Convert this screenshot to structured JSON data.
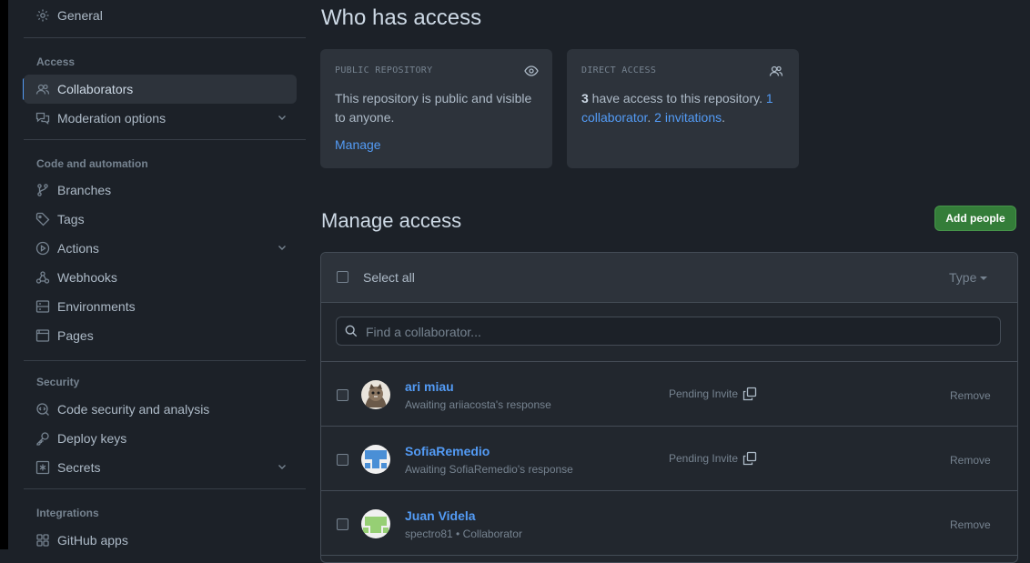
{
  "sidebar": {
    "general": {
      "label": "General",
      "icon": "gear-icon"
    },
    "sections": {
      "access": "Access",
      "code_automation": "Code and automation",
      "security": "Security",
      "integrations": "Integrations"
    },
    "items": {
      "collaborators": {
        "label": "Collaborators",
        "icon": "people-icon"
      },
      "moderation": {
        "label": "Moderation options",
        "icon": "comment-discussion-icon"
      },
      "branches": {
        "label": "Branches",
        "icon": "git-branch-icon"
      },
      "tags": {
        "label": "Tags",
        "icon": "tag-icon"
      },
      "actions": {
        "label": "Actions",
        "icon": "play-icon"
      },
      "webhooks": {
        "label": "Webhooks",
        "icon": "webhook-icon"
      },
      "environments": {
        "label": "Environments",
        "icon": "server-icon"
      },
      "pages": {
        "label": "Pages",
        "icon": "browser-icon"
      },
      "code_security": {
        "label": "Code security and analysis",
        "icon": "codescan-icon"
      },
      "deploy_keys": {
        "label": "Deploy keys",
        "icon": "key-icon"
      },
      "secrets": {
        "label": "Secrets",
        "icon": "asterisk-icon"
      },
      "github_apps": {
        "label": "GitHub apps",
        "icon": "apps-icon"
      }
    }
  },
  "who_has_access": {
    "title": "Who has access",
    "public_card": {
      "label": "PUBLIC REPOSITORY",
      "text": "This repository is public and visible to anyone.",
      "link": "Manage"
    },
    "direct_card": {
      "label": "DIRECT ACCESS",
      "count": "3",
      "text_mid": " have access to this repository. ",
      "collab_link": "1 collaborator",
      "sep": ". ",
      "invite_link": "2 invitations",
      "end": "."
    }
  },
  "manage_access": {
    "title": "Manage access",
    "add_button": "Add people",
    "select_all": "Select all",
    "type_filter": "Type",
    "search_placeholder": "Find a collaborator...",
    "members": [
      {
        "name": "ari miau",
        "sub": "Awaiting ariiacosta's response",
        "status": "Pending Invite",
        "action": "Remove"
      },
      {
        "name": "SofiaRemedio",
        "sub": "Awaiting SofiaRemedio's response",
        "status": "Pending Invite",
        "action": "Remove"
      },
      {
        "name": "Juan Videla",
        "sub": "spectro81 • Collaborator",
        "status": "",
        "action": "Remove"
      }
    ]
  },
  "colors": {
    "accent": "#539bf5",
    "button_green": "#347d39",
    "background": "#1c2128",
    "card": "#2d333b"
  }
}
